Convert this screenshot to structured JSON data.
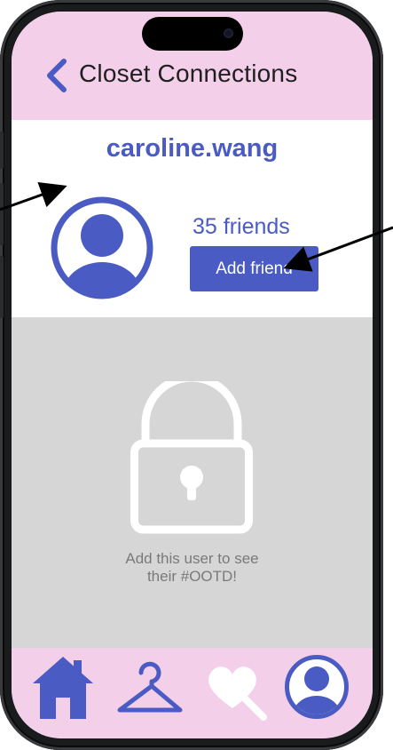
{
  "header": {
    "title": "Closet Connections",
    "back_icon": "chevron-left-icon"
  },
  "profile": {
    "username": "caroline.wang",
    "friends_count": "35 friends",
    "add_friend_label": "Add friend",
    "avatar_icon": "user-avatar-icon"
  },
  "locked": {
    "lock_icon": "padlock-icon",
    "message_line1": "Add this user to see",
    "message_line2": "their #OOTD!"
  },
  "nav": {
    "items": [
      {
        "label": "home",
        "icon": "home-icon"
      },
      {
        "label": "closet",
        "icon": "hanger-icon"
      },
      {
        "label": "favorites",
        "icon": "heart-search-icon"
      },
      {
        "label": "profile",
        "icon": "user-avatar-icon"
      }
    ]
  },
  "colors": {
    "accent": "#4a5cc3",
    "header_bg": "#f3cfe9",
    "locked_bg": "#d6d6d6",
    "message": "#7a7a7a"
  }
}
